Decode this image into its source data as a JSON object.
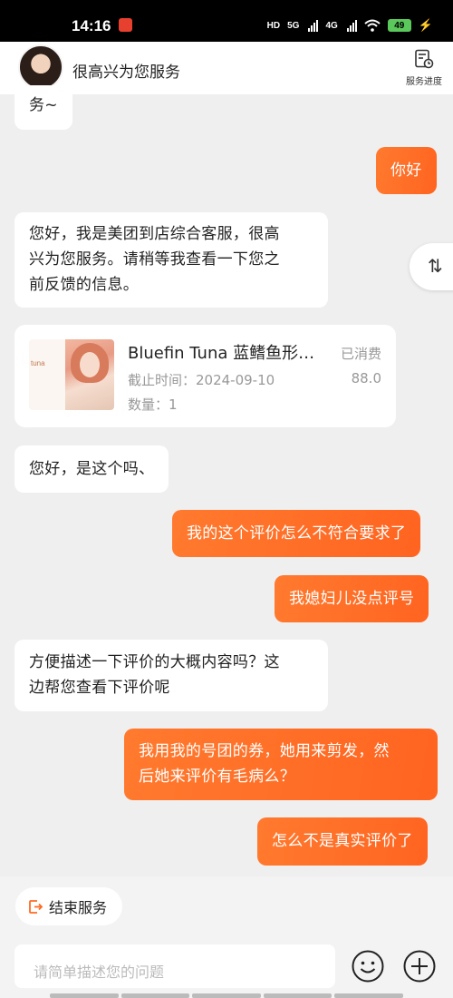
{
  "status_bar": {
    "time": "14:16",
    "hd_label": "HD",
    "net1": "5G",
    "net2": "4G",
    "battery": "49"
  },
  "header": {
    "title": "很高兴为您服务",
    "progress_label": "服务进度"
  },
  "messages": [
    {
      "side": "left",
      "text": "务~"
    },
    {
      "side": "right",
      "text": "你好"
    },
    {
      "side": "left",
      "lines": [
        "您好，我是美团到店综合客服，很高",
        "兴为您服务。请稍等我查看一下您之",
        "前反馈的信息。"
      ]
    },
    {
      "side": "left",
      "text": "您好，是这个吗、"
    },
    {
      "side": "right",
      "text": "我的这个评价怎么不符合要求了"
    },
    {
      "side": "right",
      "text": "我媳妇儿没点评号"
    },
    {
      "side": "left",
      "lines": [
        "方便描述一下评价的大概内容吗？这",
        "边帮您查看下评价呢"
      ]
    },
    {
      "side": "right",
      "lines": [
        "我用我的号团的券，她用来剪发，然",
        "后她来评价有毛病么？"
      ]
    },
    {
      "side": "right",
      "text": "怎么不是真实评价了"
    }
  ],
  "product_card": {
    "image_text": "tuna",
    "title": "Bluefin Tuna 蓝鳍鱼形…",
    "status": "已消费",
    "deadline_label": "截止时间：2024-09-10",
    "price": "88.0",
    "quantity_label": "数量：1"
  },
  "side_tab": {
    "symbol": "⇅"
  },
  "bottom": {
    "end_service_label": "结束服务",
    "input_placeholder": "请简单描述您的问题"
  },
  "colors": {
    "accent": "#ff6a22",
    "background": "#efefef"
  }
}
